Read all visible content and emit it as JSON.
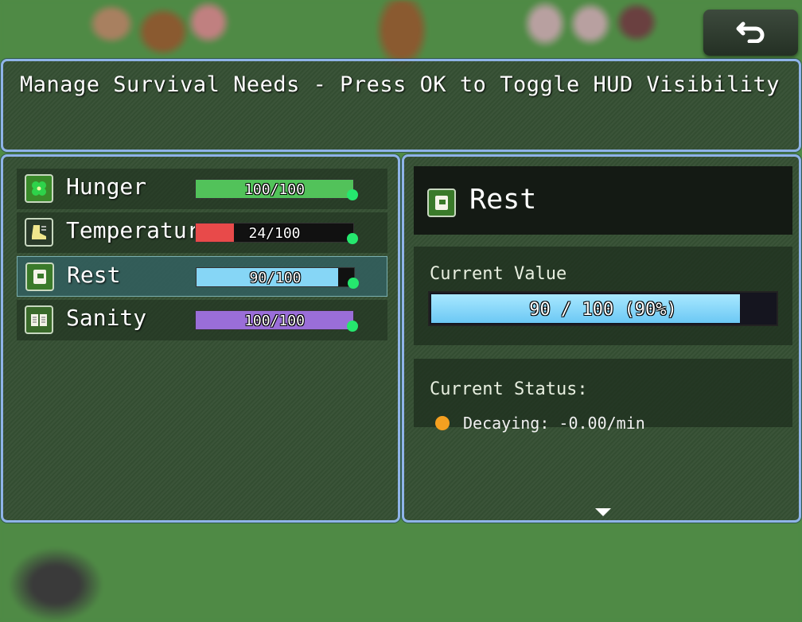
{
  "help_text": "Manage Survival Needs - Press OK to Toggle HUD Visibility",
  "back_button": {
    "icon": "return-arrow-icon"
  },
  "needs": [
    {
      "label": "Hunger",
      "value_text": "100/100",
      "fraction": 1.0,
      "bar_color": "#52c25a",
      "icon": "clover-icon"
    },
    {
      "label": "Temperature",
      "value_text": "24/100",
      "fraction": 0.24,
      "bar_color": "#e84a4a",
      "icon": "boot-icon"
    },
    {
      "label": "Rest",
      "value_text": "90/100",
      "fraction": 0.9,
      "bar_color": "#86d6f6",
      "icon": "bed-icon",
      "selected": true
    },
    {
      "label": "Sanity",
      "value_text": "100/100",
      "fraction": 1.0,
      "bar_color": "#9a6ed8",
      "icon": "book-icon"
    }
  ],
  "detail": {
    "title": "Rest",
    "icon": "bed-icon",
    "current_value_label": "Current Value",
    "current_value_text": "90 / 100 (90%)",
    "current_fraction": 0.9,
    "current_status_label": "Current Status:",
    "status_text": "Decaying: -0.00/min",
    "status_color": "#f5a020"
  },
  "colors": {
    "panel_border": "#8fb4e8",
    "indicator_dot": "#25e86e"
  }
}
